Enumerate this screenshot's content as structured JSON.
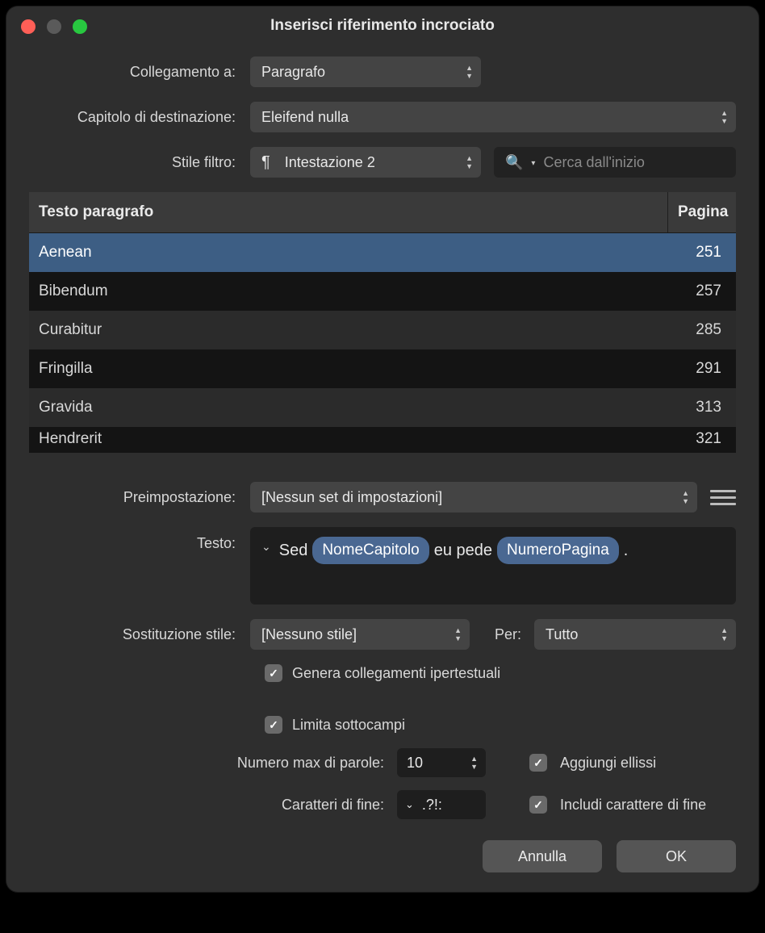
{
  "window_title": "Inserisci riferimento incrociato",
  "labels": {
    "link_to": "Collegamento a:",
    "chapter": "Capitolo di destinazione:",
    "filter": "Stile filtro:",
    "preset": "Preimpostazione:",
    "text": "Testo:",
    "style_sub": "Sostituzione stile:",
    "per": "Per:",
    "max_words": "Numero max di parole:",
    "end_chars": "Caratteri di fine:"
  },
  "selects": {
    "link_to": "Paragrafo",
    "chapter": "Eleifend nulla",
    "filter": "Intestazione 2",
    "preset": "[Nessun set di impostazioni]",
    "style_sub": "[Nessuno stile]",
    "per": "Tutto"
  },
  "search_placeholder": "Cerca dall'inizio",
  "table": {
    "col_text": "Testo paragrafo",
    "col_page": "Pagina",
    "rows": [
      {
        "text": "Aenean",
        "page": "251",
        "selected": true
      },
      {
        "text": "Bibendum",
        "page": "257"
      },
      {
        "text": "Curabitur",
        "page": "285"
      },
      {
        "text": "Fringilla",
        "page": "291"
      },
      {
        "text": "Gravida",
        "page": "313"
      },
      {
        "text": "Hendrerit",
        "page": "321"
      }
    ]
  },
  "testo": {
    "pre": "Sed",
    "chip1": "NomeCapitolo",
    "mid": "eu pede",
    "chip2": "NumeroPagina",
    "post": "."
  },
  "checkboxes": {
    "hyperlinks": "Genera collegamenti ipertestuali",
    "limit_sub": "Limita sottocampi",
    "ellipsis": "Aggiungi ellissi",
    "include_end": "Includi carattere di fine"
  },
  "max_words_value": "10",
  "end_chars_value": ".?!:",
  "buttons": {
    "cancel": "Annulla",
    "ok": "OK"
  }
}
